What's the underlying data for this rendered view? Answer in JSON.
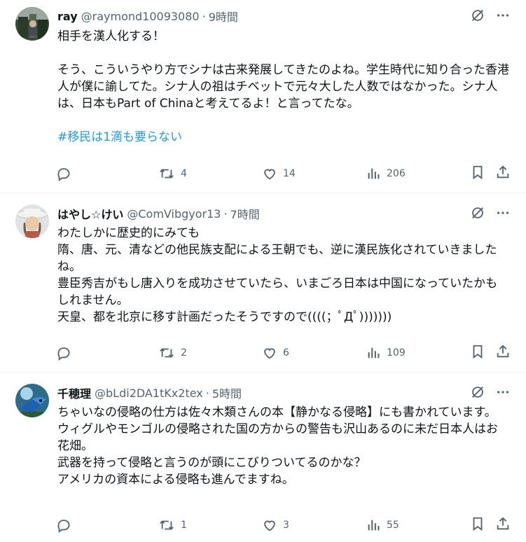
{
  "colors": {
    "text": "#0f1419",
    "muted": "#536471",
    "link": "#1d9bf0",
    "divider": "#eff3f4"
  },
  "tweets": [
    {
      "name": "ray",
      "handle": "@raymond10093080",
      "sep": "·",
      "time": "9時間",
      "paragraphs": [
        "相手を漢人化する！",
        "",
        "そう、こういうやり方でシナは古来発展してきたのよね。学生時代に知り合った香港人が僕に諭してた。シナ人の祖はチベットで元々大した人数ではなかった。シナ人は、日本もPart of Chinaと考えてるよ！と言ってたな。",
        ""
      ],
      "hashtag": "#移民は1滴も要らない",
      "replies": "",
      "retweets": "4",
      "likes": "14",
      "views": "206"
    },
    {
      "name": "はやし☆けい",
      "handle": "@ComVibgyor13",
      "sep": "·",
      "time": "7時間",
      "paragraphs": [
        "わたしかに歴史的にみても",
        "隋、唐、元、清などの他民族支配による王朝でも、逆に漢民族化されていきましたね。",
        "豊臣秀吉がもし唐入りを成功させていたら、いまごろ日本は中国になっていたかもしれません。",
        "天皇、都を北京に移す計画だったそうですので((((；ﾟДﾟ)))))))"
      ],
      "replies": "",
      "retweets": "2",
      "likes": "6",
      "views": "109"
    },
    {
      "name": "千穂理",
      "handle": "@bLdi2DA1tKx2tex",
      "sep": "·",
      "time": "5時間",
      "paragraphs": [
        "ちゃいなの侵略の仕方は佐々木類さんの本【静かなる侵略】にも書かれています。",
        "ウィグルやモンゴルの侵略された国の方からの警告も沢山あるのに未だ日本人はお花畑。",
        "武器を持って侵略と言うのが頭にこびりついてるのかな？",
        "アメリカの資本による侵略も進んでますね。"
      ],
      "replies": "",
      "retweets": "1",
      "likes": "3",
      "views": "55"
    }
  ],
  "icons": {
    "grok": "grok-icon",
    "more": "more-icon",
    "reply": "reply-icon",
    "retweet": "retweet-icon",
    "like": "like-icon",
    "views": "views-icon",
    "bookmark": "bookmark-icon",
    "share": "share-icon"
  }
}
